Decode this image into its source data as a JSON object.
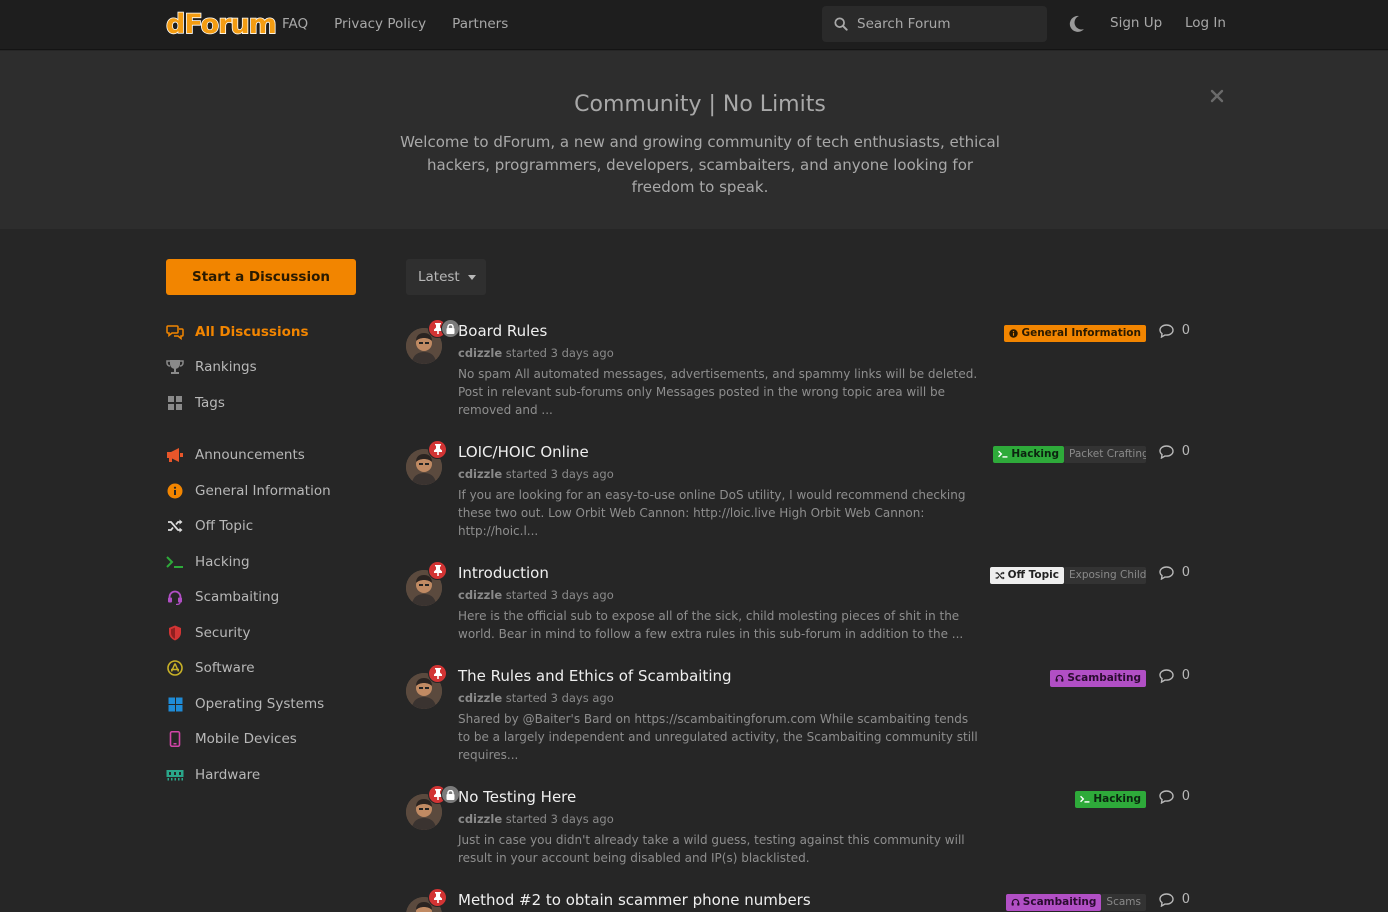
{
  "header": {
    "logo_text": "dForum",
    "nav": [
      "FAQ",
      "Privacy Policy",
      "Partners"
    ],
    "search_placeholder": "Search Forum",
    "signup_label": "Sign Up",
    "login_label": "Log In"
  },
  "hero": {
    "title": "Community | No Limits",
    "description": "Welcome to dForum, a new and growing community of tech enthusiasts, ethical hackers, programmers, developers, scambaiters, and anyone looking for freedom to speak."
  },
  "sidebar": {
    "start_label": "Start a Discussion",
    "items": [
      {
        "label": "All Discussions",
        "icon": "chat-icon",
        "color": "#f28500"
      },
      {
        "label": "Rankings",
        "icon": "trophy-icon",
        "color": "#8a8a8a"
      },
      {
        "label": "Tags",
        "icon": "grid-icon",
        "color": "#8a8a8a"
      },
      {
        "label": "Announcements",
        "icon": "megaphone-icon",
        "color": "#e8562a"
      },
      {
        "label": "General Information",
        "icon": "info-icon",
        "color": "#f28500"
      },
      {
        "label": "Off Topic",
        "icon": "shuffle-icon",
        "color": "#dddddd"
      },
      {
        "label": "Hacking",
        "icon": "terminal-icon",
        "color": "#2eaa3a"
      },
      {
        "label": "Scambaiting",
        "icon": "headset-icon",
        "color": "#b14fc5"
      },
      {
        "label": "Security",
        "icon": "shield-icon",
        "color": "#d23434"
      },
      {
        "label": "Software",
        "icon": "appstore-icon",
        "color": "#c9b227"
      },
      {
        "label": "Operating Systems",
        "icon": "windows-icon",
        "color": "#1f8bd6"
      },
      {
        "label": "Mobile Devices",
        "icon": "mobile-icon",
        "color": "#d245a8"
      },
      {
        "label": "Hardware",
        "icon": "memory-icon",
        "color": "#2aa68a"
      }
    ]
  },
  "sort": {
    "label": "Latest"
  },
  "started_text": "started",
  "discussions": [
    {
      "title": "Board Rules",
      "author": "cdizzle",
      "time": "3 days ago",
      "excerpt": "No spam All automated messages, advertisements, and spammy links will be deleted. Post in relevant sub-forums only Messages posted in the wrong topic area will be removed and ...",
      "locked": true,
      "tags": [
        {
          "label": "General Information",
          "icon": "info-icon",
          "bg": "#f28500",
          "fg": "#2a1a00"
        }
      ],
      "replies": "0"
    },
    {
      "title": "LOIC/HOIC Online",
      "author": "cdizzle",
      "time": "3 days ago",
      "excerpt": "If you are looking for an easy-to-use online DoS utility, I would recommend checking these two out. Low Orbit Web Cannon: http://loic.live High Orbit Web Cannon: http://hoic.l...",
      "locked": false,
      "tags": [
        {
          "label": "Hacking",
          "icon": "terminal-icon",
          "bg": "#2eaa3a",
          "fg": "#0c2410"
        }
      ],
      "secondary_tag": "Packet Crafting",
      "replies": "0"
    },
    {
      "title": "Introduction",
      "author": "cdizzle",
      "time": "3 days ago",
      "excerpt": "Here is the official sub to expose all of the sick, child molesting pieces of shit in the world. Bear in mind to follow a few extra rules in this sub-forum in addition to the ...",
      "locked": false,
      "tags": [
        {
          "label": "Off Topic",
          "icon": "shuffle-icon",
          "bg": "#eeeeee",
          "fg": "#222222"
        }
      ],
      "secondary_tag": "Exposing Child",
      "replies": "0"
    },
    {
      "title": "The Rules and Ethics of Scambaiting",
      "author": "cdizzle",
      "time": "3 days ago",
      "excerpt": "Shared by @Baiter's Bard on https://scambaitingforum.com While scambaiting tends to be a largely independent and unregulated activity, the Scambaiting community still requires...",
      "locked": false,
      "tags": [
        {
          "label": "Scambaiting",
          "icon": "headset-icon",
          "bg": "#b14fc5",
          "fg": "#2a0c30"
        }
      ],
      "replies": "0"
    },
    {
      "title": "No Testing Here",
      "author": "cdizzle",
      "time": "3 days ago",
      "excerpt": "Just in case you didn't already take a wild guess, testing against this community will result in your account being disabled and IP(s) blacklisted.",
      "locked": true,
      "tags": [
        {
          "label": "Hacking",
          "icon": "terminal-icon",
          "bg": "#2eaa3a",
          "fg": "#0c2410"
        }
      ],
      "replies": "0"
    },
    {
      "title": "Method #2 to obtain scammer phone numbers",
      "author": "",
      "time": "",
      "excerpt": "",
      "locked": false,
      "tags": [
        {
          "label": "Scambaiting",
          "icon": "headset-icon",
          "bg": "#b14fc5",
          "fg": "#2a0c30"
        }
      ],
      "secondary_tag": "Scams",
      "replies": "0"
    }
  ]
}
